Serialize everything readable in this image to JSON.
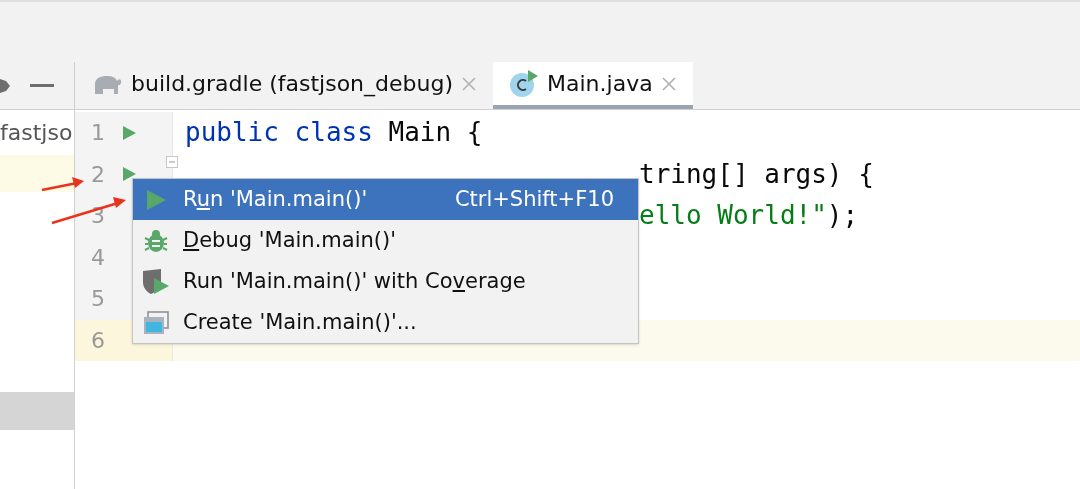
{
  "project_panel": {
    "label": "fastjso"
  },
  "tabs": [
    {
      "label": "build.gradle (fastjson_debug)",
      "kind": "gradle",
      "selected": false
    },
    {
      "label": "Main.java",
      "kind": "java",
      "selected": true
    }
  ],
  "lines": [
    {
      "number": "1",
      "run": true,
      "fold": false,
      "current": false,
      "after_menu": false,
      "tokens": [
        {
          "kind": "keyword",
          "text": "public"
        },
        {
          "kind": "keyword",
          "text": "class"
        },
        {
          "kind": "plain",
          "text": "Main {"
        }
      ]
    },
    {
      "number": "2",
      "run": true,
      "fold": true,
      "current": false,
      "after_menu": true,
      "tokens": [
        {
          "kind": "plain",
          "text": "tring[] args) {"
        }
      ]
    },
    {
      "number": "3",
      "run": false,
      "fold": false,
      "current": false,
      "after_menu": true,
      "tokens": [
        {
          "kind": "string",
          "text": "ello World!\""
        },
        {
          "kind": "plain",
          "text": ");"
        }
      ]
    },
    {
      "number": "4",
      "run": false,
      "fold": false,
      "current": false,
      "after_menu": false
    },
    {
      "number": "5",
      "run": false,
      "fold": false,
      "current": false,
      "after_menu": false
    },
    {
      "number": "6",
      "run": false,
      "fold": false,
      "current": true,
      "after_menu": false
    }
  ],
  "context_menu": {
    "items": [
      {
        "kind": "run",
        "before": "R",
        "mnemonic": "u",
        "after": "n 'Main.main()'",
        "shortcut": "Ctrl+Shift+F10",
        "selected": true
      },
      {
        "kind": "debug",
        "mnemonic": "D",
        "after": "ebug 'Main.main()'",
        "selected": false
      },
      {
        "kind": "coverage",
        "before": "Run 'Main.main()' with Co",
        "mnemonic": "v",
        "after": "erage",
        "selected": false
      },
      {
        "kind": "create",
        "before": "Create 'Main.main()'...",
        "selected": false
      }
    ]
  }
}
